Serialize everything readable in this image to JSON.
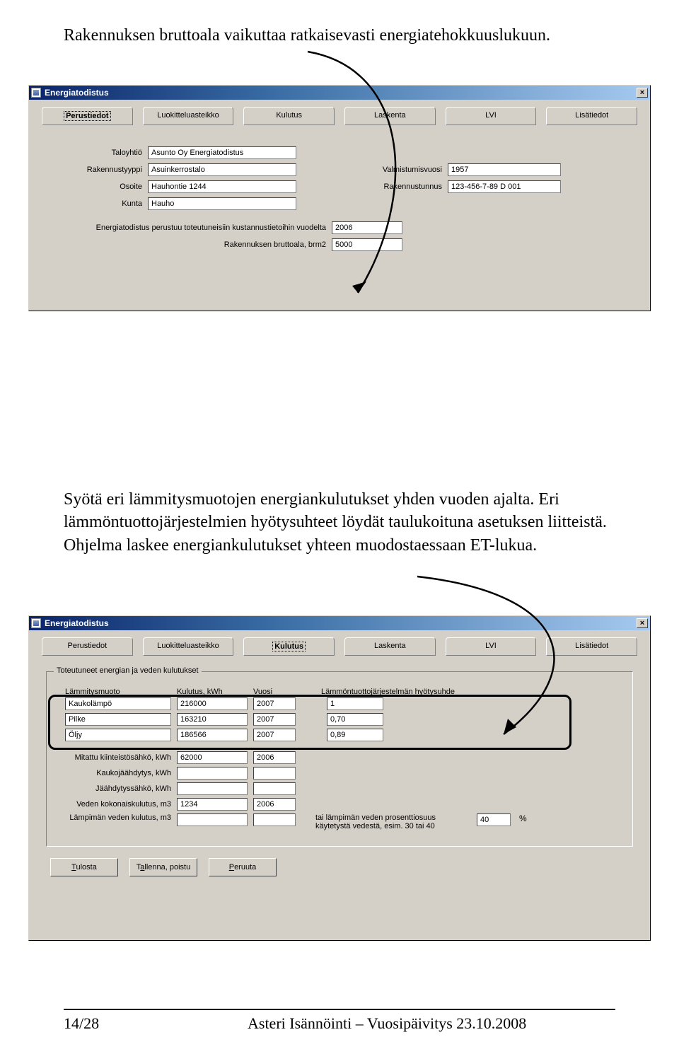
{
  "page": {
    "intro1": "Rakennuksen bruttoala vaikuttaa ratkaisevasti energiatehokkuuslukuun.",
    "intro2": "Syötä eri lämmitysmuotojen energiankulutukset yhden vuoden ajalta. Eri lämmöntuottojärjestelmien hyötysuhteet löydät taulukoituna asetuksen liitteistä. Ohjelma laskee energiankulutukset yhteen muodostaessaan ET-lukua."
  },
  "window1": {
    "title": "Energiatodistus",
    "tabs": [
      "Perustiedot",
      "Luokitteluasteikko",
      "Kulutus",
      "Laskenta",
      "LVI",
      "Lisätiedot"
    ],
    "labels": {
      "taloyhtio": "Taloyhtiö",
      "rakennustyyppi": "Rakennustyyppi",
      "osoite": "Osoite",
      "kunta": "Kunta",
      "valmistumisvuosi": "Valmistumisvuosi",
      "rakennustunnus": "Rakennustunnus",
      "perustuu": "Energiatodistus perustuu toteutuneisiin kustannustietoihin vuodelta",
      "bruttoala": "Rakennuksen bruttoala, brm2"
    },
    "values": {
      "taloyhtio": "Asunto Oy Energiatodistus",
      "rakennustyyppi": "Asuinkerrostalo",
      "osoite": "Hauhontie 1244",
      "kunta": "Hauho",
      "valmistumisvuosi": "1957",
      "rakennustunnus": "123-456-7-89 D 001",
      "perustuu_vuosi": "2006",
      "bruttoala": "5000"
    }
  },
  "window2": {
    "title": "Energiatodistus",
    "tabs": [
      "Perustiedot",
      "Luokitteluasteikko",
      "Kulutus",
      "Laskenta",
      "LVI",
      "Lisätiedot"
    ],
    "group_legend": "Toteutuneet energian ja veden kulutukset",
    "headers": {
      "muoto": "Lämmitysmuoto",
      "kulutus": "Kulutus, kWh",
      "vuosi": "Vuosi",
      "suhde": "Lämmöntuottojärjestelmän hyötysuhde"
    },
    "heating_rows": [
      {
        "muoto": "Kaukolämpö",
        "kulutus": "216000",
        "vuosi": "2007",
        "suhde": "1"
      },
      {
        "muoto": "Pilke",
        "kulutus": "163210",
        "vuosi": "2007",
        "suhde": "0,70"
      },
      {
        "muoto": "Öljy",
        "kulutus": "186566",
        "vuosi": "2007",
        "suhde": "0,89"
      }
    ],
    "extra_rows": {
      "kiinteistosahko": {
        "label": "Mitattu kiinteistösähkö, kWh",
        "val": "62000",
        "vuosi": "2006"
      },
      "kaukojaahdytys": {
        "label": "Kaukojäähdytys, kWh",
        "val": "",
        "vuosi": ""
      },
      "jaahdytyssahko": {
        "label": "Jäähdytyssähkö, kWh",
        "val": "",
        "vuosi": ""
      },
      "vesikulutus": {
        "label": "Veden kokonaiskulutus, m3",
        "val": "1234",
        "vuosi": "2006"
      },
      "lampimavesi": {
        "label": "Lämpimän veden kulutus, m3",
        "val": "",
        "vuosi": "",
        "desc": "tai lämpimän veden prosenttiosuus käytetystä vedestä, esim. 30 tai 40",
        "pct": "40",
        "pctunit": "%"
      }
    },
    "buttons": {
      "tulosta": "Tulosta",
      "tallenna": "Tallenna, poistu",
      "peruuta": "Peruuta"
    }
  },
  "footer": {
    "pagenum": "14/28",
    "text": "Asteri Isännöinti – Vuosipäivitys 23.10.2008"
  }
}
